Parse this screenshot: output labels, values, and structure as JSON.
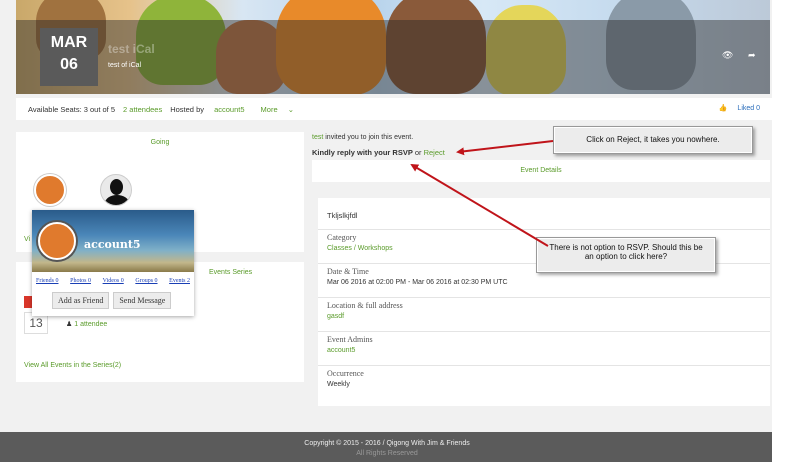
{
  "event": {
    "month": "MAR",
    "day": "06",
    "title": "test iCal",
    "subtitle": "test of iCal"
  },
  "info_bar": {
    "seats": "Available Seats: 3 out of 5",
    "attendees": "2 attendees",
    "hosted_label": "Hosted by",
    "host": "account5",
    "more": "More",
    "liked": "Liked 0"
  },
  "going": {
    "title": "Going",
    "view_text": "Vi"
  },
  "series": {
    "title": "Events Series",
    "date": "13",
    "attendee": "1 attendee",
    "view_all": "View All Events in the Series(2)"
  },
  "popup": {
    "name": "account5",
    "tabs": [
      "Friends 0",
      "Photos 0",
      "Videos 0",
      "Groups 0",
      "Events 2"
    ],
    "add_friend": "Add as Friend",
    "send_message": "Send Message"
  },
  "invite": {
    "user": "test",
    "text": "invited you to join this event.",
    "reply_text": "Kindly reply with your RSVP",
    "or": "or",
    "reject": "Reject"
  },
  "details": {
    "tab": "Event Details",
    "description": "Tkljslkjfdl",
    "rows": [
      {
        "label": "Category",
        "value": "Classes / Workshops"
      },
      {
        "label": "Date & Time",
        "value": "Mar 06 2016 at 02:00 PM - Mar 06 2016 at 02:30 PM UTC"
      },
      {
        "label": "Location & full address",
        "value": "gasdf"
      },
      {
        "label": "Event Admins",
        "value": "account5"
      },
      {
        "label": "Occurrence",
        "value": "Weekly"
      }
    ]
  },
  "callouts": {
    "reject_note": "Click on Reject, it takes you nowhere.",
    "rsvp_note": "There is not option to RSVP.  Should this be an option to click here?"
  },
  "footer": {
    "copyright": "Copyright © 2015 - 2016 / Qigong With Jim & Friends",
    "rights": "All Rights Reserved"
  },
  "colors": {
    "accent_green": "#5a9b2a",
    "arrow_red": "#c0141a",
    "footer": "#5b5b5b"
  }
}
